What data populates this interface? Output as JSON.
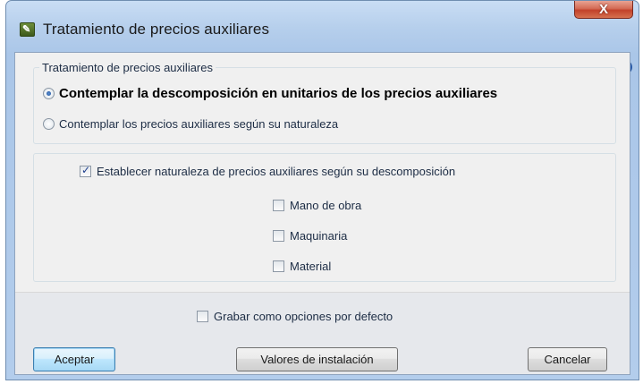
{
  "window": {
    "title": "Tratamiento de precios auxiliares",
    "close_label": "X",
    "help_label": "?"
  },
  "group_treatment": {
    "label": "Tratamiento de precios auxiliares",
    "options": [
      {
        "label": "Contemplar la descomposición en unitarios de los precios auxiliares",
        "selected": true
      },
      {
        "label": "Contemplar los precios auxiliares según su naturaleza",
        "selected": false
      }
    ]
  },
  "group_nature": {
    "main_checkbox": {
      "label": "Establecer naturaleza de precios auxiliares según su descomposición",
      "checked": true
    },
    "sub_checkboxes": [
      {
        "label": "Mano de obra",
        "checked": false
      },
      {
        "label": "Maquinaria",
        "checked": false
      },
      {
        "label": "Material",
        "checked": false
      }
    ]
  },
  "footer": {
    "default_checkbox": {
      "label": "Grabar como opciones por defecto",
      "checked": false
    },
    "buttons": {
      "accept": "Aceptar",
      "install_defaults": "Valores de instalación",
      "cancel": "Cancelar"
    }
  }
}
